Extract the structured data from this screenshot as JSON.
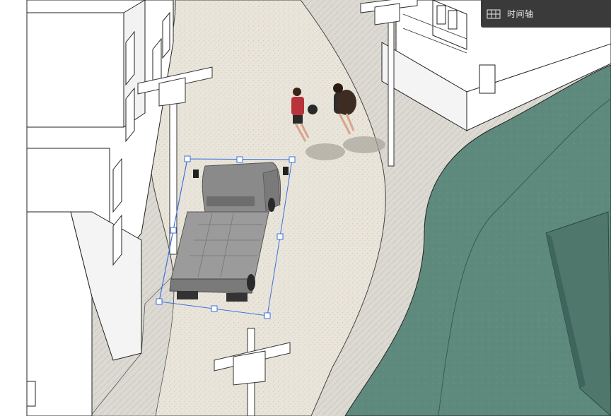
{
  "panel": {
    "title": "时间轴",
    "icon": "timeline-icon"
  },
  "scene": {
    "selection_color": "#3a6fe0",
    "road_color": "#e8e4da",
    "sidewalk_color": "#dcdad2",
    "grass_color": "#5f8a7e",
    "selected_object": "truck"
  }
}
